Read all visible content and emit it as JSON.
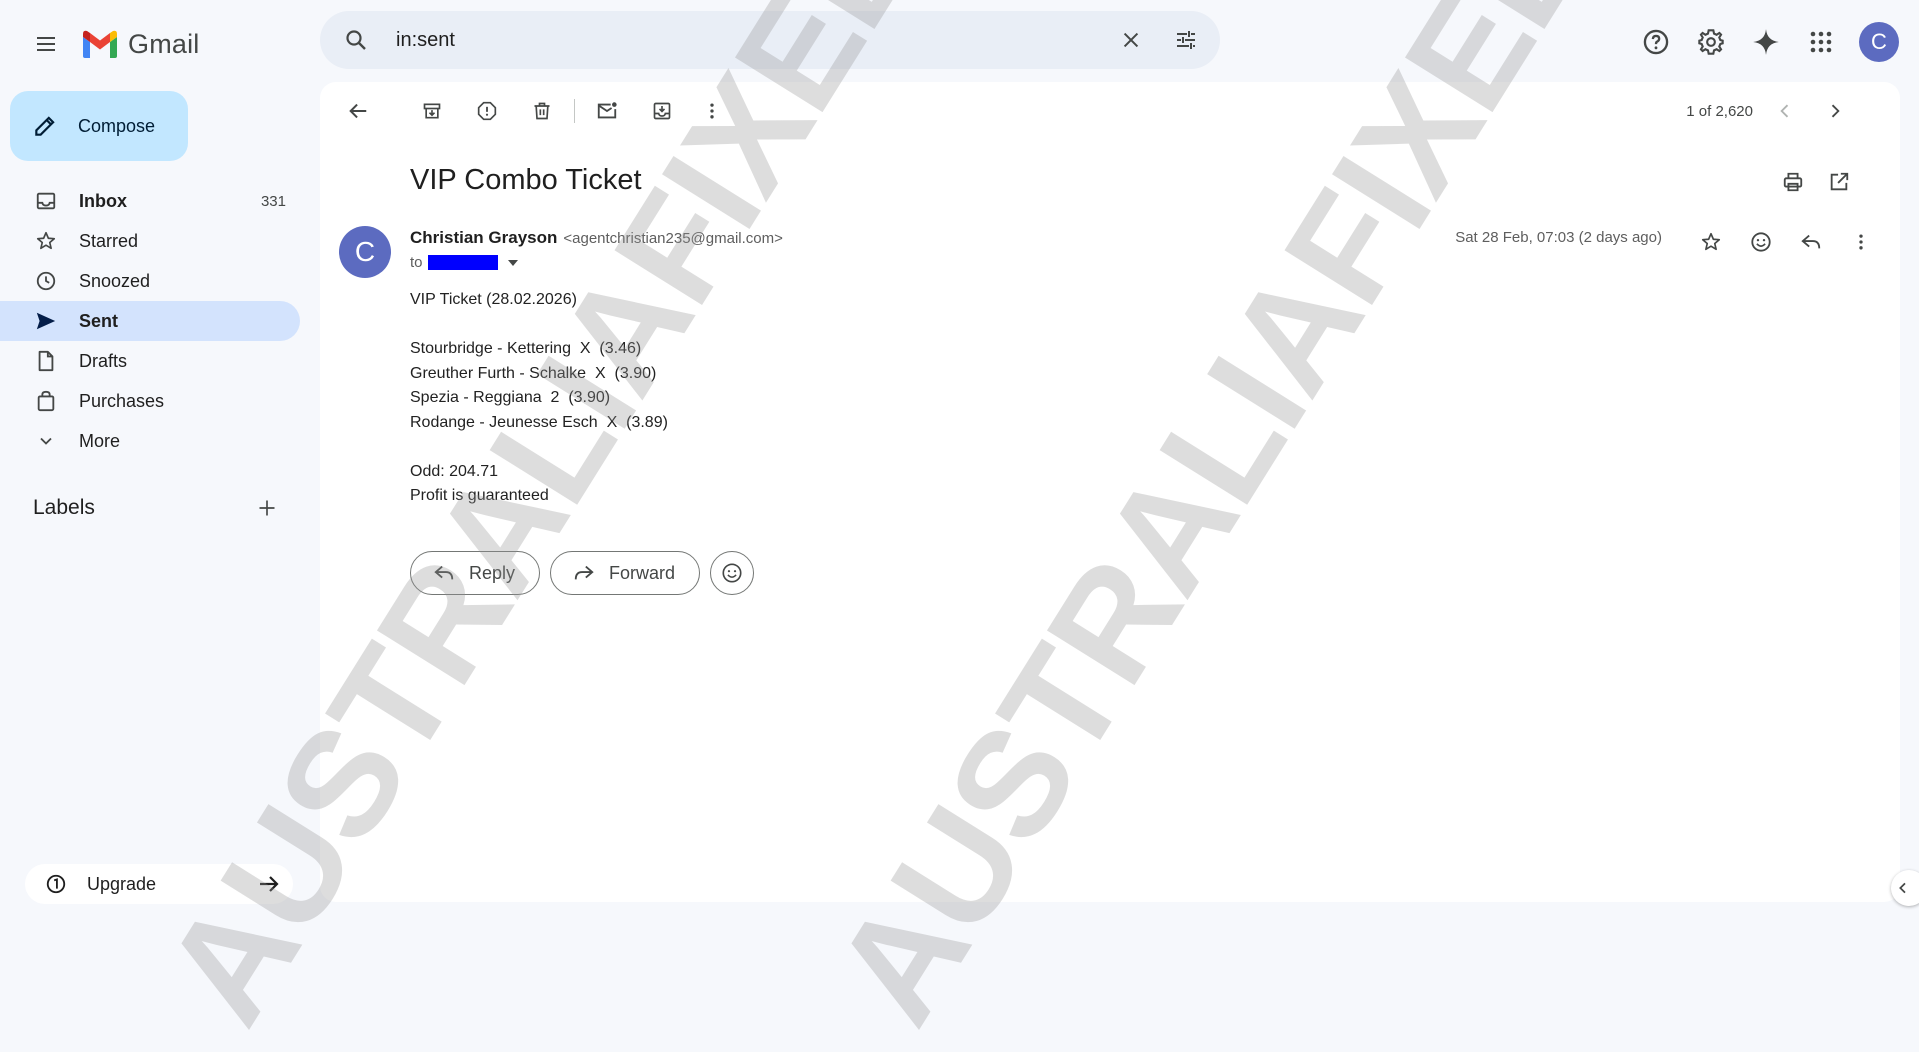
{
  "app": {
    "name": "Gmail"
  },
  "search": {
    "value": "in:sent"
  },
  "user": {
    "initial": "C"
  },
  "compose": {
    "label": "Compose"
  },
  "sidebar": {
    "items": [
      {
        "label": "Inbox",
        "count": "331",
        "icon": "inbox-icon"
      },
      {
        "label": "Starred",
        "count": "",
        "icon": "star-icon"
      },
      {
        "label": "Snoozed",
        "count": "",
        "icon": "clock-icon"
      },
      {
        "label": "Sent",
        "count": "",
        "icon": "send-icon",
        "active": true
      },
      {
        "label": "Drafts",
        "count": "",
        "icon": "draft-icon"
      },
      {
        "label": "Purchases",
        "count": "",
        "icon": "purchases-icon"
      },
      {
        "label": "More",
        "count": "",
        "icon": "chevron-down-icon"
      }
    ],
    "labels_heading": "Labels",
    "upgrade_label": "Upgrade"
  },
  "pager": {
    "text": "1 of 2,620"
  },
  "email": {
    "subject": "VIP Combo Ticket",
    "sender_initial": "C",
    "sender_name": "Christian Grayson",
    "sender_email": "<agentchristian235@gmail.com>",
    "to_prefix": "to",
    "date": "Sat 28 Feb, 07:03 (2 days ago)",
    "body_lines": [
      "VIP Ticket (28.02.2026)",
      "",
      "Stourbridge - Kettering  X  (3.46)",
      "Greuther Furth - Schalke  X  (3.90)",
      "Spezia - Reggiana  2  (3.90)",
      "Rodange - Jeunesse Esch  X  (3.89)",
      "",
      "Odd: 204.71",
      "Profit is guaranteed"
    ]
  },
  "actions": {
    "reply": "Reply",
    "forward": "Forward"
  },
  "watermark": {
    "text": "AUSTRALIAFIXEDMATCHES"
  },
  "colors": {
    "compose_bg": "#c2e7ff",
    "active_nav": "#d3e3fd",
    "avatar": "#5c6bc0",
    "redaction": "#0000ff"
  }
}
